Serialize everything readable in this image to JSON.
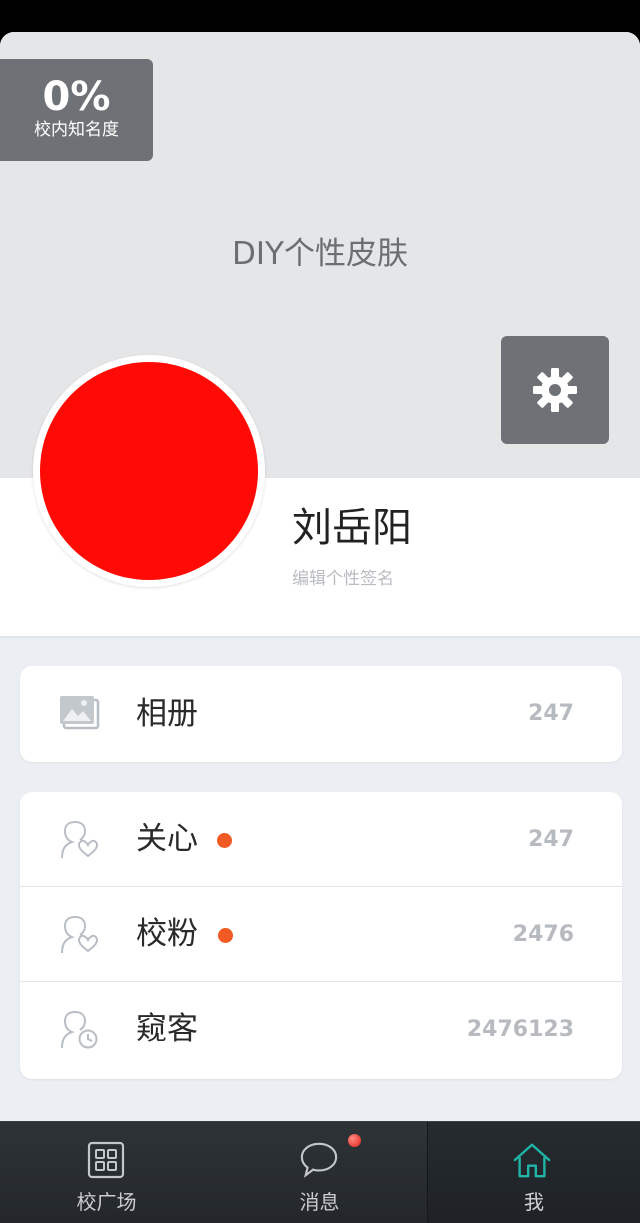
{
  "header": {
    "fame_percent": "0%",
    "fame_label": "校内知名度",
    "diy_title": "DIY个性皮肤"
  },
  "profile": {
    "name": "刘岳阳",
    "signature_placeholder": "编辑个性签名",
    "avatar_color": "#ff0a05"
  },
  "album": {
    "label": "相册",
    "count": "247"
  },
  "social": [
    {
      "label": "关心",
      "count": "247",
      "has_dot": true
    },
    {
      "label": "校粉",
      "count": "2476",
      "has_dot": true
    },
    {
      "label": "窥客",
      "count": "2476123",
      "has_dot": false
    }
  ],
  "tabs": [
    {
      "label": "校广场",
      "icon": "grid-icon"
    },
    {
      "label": "消息",
      "icon": "chat-bubble-icon",
      "has_badge": true
    },
    {
      "label": "我",
      "icon": "home-icon",
      "active": true
    }
  ],
  "colors": {
    "accent_active": "#1fb5a8",
    "notification_dot": "#f15a22"
  }
}
